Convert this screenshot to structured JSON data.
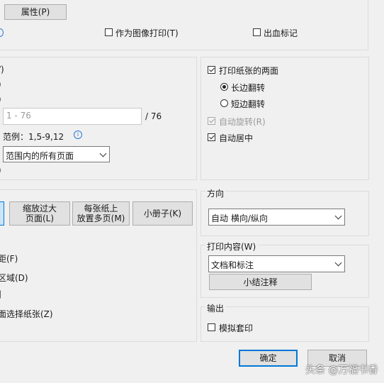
{
  "top": {
    "properties_button": "属性(P)",
    "print_as_image": "作为图像打印(T)",
    "bleed_marks": "出血标记"
  },
  "page_range": {
    "frag_1": "/)",
    "frag_2": ")",
    "frag_3": ")",
    "pages_placeholder": "1 - 76",
    "pages_total": "/ 76",
    "example": "范例：1,5-9,12",
    "info_icon": "info-icon",
    "subset_value": "范围内的所有页面",
    "frag_4": ")"
  },
  "duplex": {
    "both_sides": "打印纸张的两面",
    "long_edge": "长边翻转",
    "short_edge": "短边翻转",
    "auto_rotate": "自动旋转(R)",
    "auto_center": "自动居中"
  },
  "sizing": {
    "shrink_oversized": [
      "缩放过大",
      "页面(L)"
    ],
    "multiple_per_sheet": [
      "每张纸上",
      "放置多页(M)"
    ],
    "booklet": "小册子(K)",
    "frag_margin": "距(F)",
    "frag_area": "区域(D)",
    "frag_bar": "]",
    "frag_choose_paper": "面选择纸张(Z)"
  },
  "orientation": {
    "title": "方向",
    "value": "自动 横向/纵向"
  },
  "print_content": {
    "title": "打印内容(W)",
    "value": "文档和标注",
    "summary_button": "小结注释"
  },
  "output": {
    "title": "输出",
    "simulate_overprint": "模拟套印"
  },
  "footer": {
    "ok": "确定",
    "cancel": "取消"
  },
  "watermark": "头条 @万福书香"
}
